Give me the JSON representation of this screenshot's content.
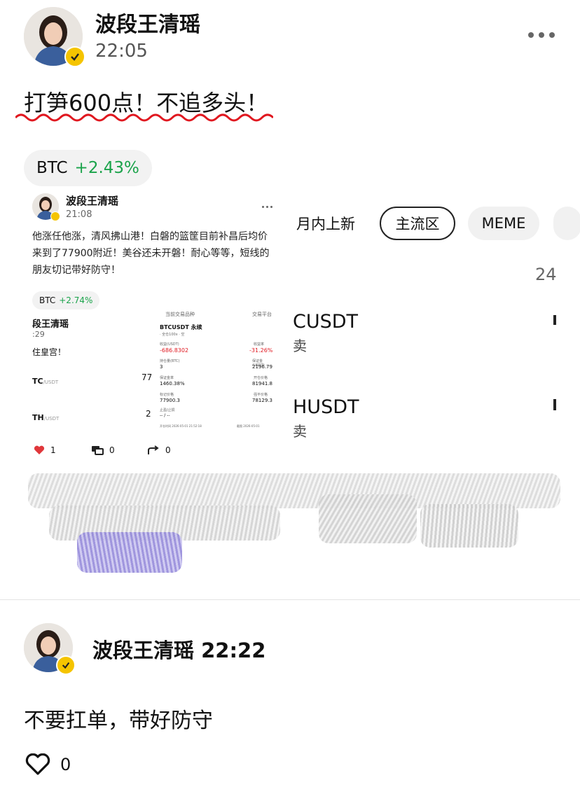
{
  "post": {
    "author": "波段王清瑶",
    "time": "22:05",
    "headline": "打笋600点！不追多头！",
    "more_icon": "more-dots-icon",
    "ticker_chip": {
      "symbol": "BTC",
      "change": "+2.43%"
    }
  },
  "background_tabs": [
    "月内上新",
    "主流区",
    "MEME"
  ],
  "background_list": {
    "count_label": "24",
    "rows": [
      {
        "symbol": "CUSDT",
        "sub": "卖"
      },
      {
        "symbol": "HUSDT",
        "sub": "卖"
      }
    ]
  },
  "embedded_post": {
    "author": "波段王清瑶",
    "time": "21:08",
    "body": "他涨任他涨，清风拂山港！白磐的篮筐目前补昌后均价来到了77900附近！美谷还未开磐！耐心等等，短线的朋友切记带好防守！",
    "ticker_chip": {
      "symbol": "BTC",
      "change": "+2.74%"
    },
    "likes": "1",
    "comments": "0",
    "shares": "0",
    "left_partial": {
      "name": "段王清瑶",
      "time": ":29",
      "text": "住皇宫！",
      "row1": {
        "sym": "TC",
        "unit": "/USDT",
        "val": "77"
      },
      "row2": {
        "sym": "TH",
        "unit": "/USDT",
        "val": "2"
      }
    },
    "card": {
      "header_left": "当前交易品种",
      "header_right": "交易平台",
      "pair": "BTCUSDT 永续",
      "sub": "· 全仓100x · 空",
      "pnl_label": "收益(USDT)",
      "pnl": "-686.8302",
      "rate_label": "收益率",
      "rate": "-31.26%",
      "size_label": "持仓量(BTC)",
      "size": "3",
      "margin_label": "保证金(USDT)",
      "margin": "2196.79",
      "ratio_label": "保证金率",
      "ratio": "1460.38%",
      "open_label": "开仓价格",
      "open": "81941.8",
      "entry_label": "标记价格",
      "entry": "77900.3",
      "liq_label": "强平价格",
      "liq": "78129.3",
      "close_label": "止盈/止损",
      "close": "-- / --",
      "footer_left": "开仓时间 2026-05-01 21:52:18",
      "footer_right": "截图 2026-05-01"
    }
  },
  "reply": {
    "author_time": "波段王清瑶 22:22",
    "text": "不要扛单，带好防守",
    "likes": "0"
  }
}
